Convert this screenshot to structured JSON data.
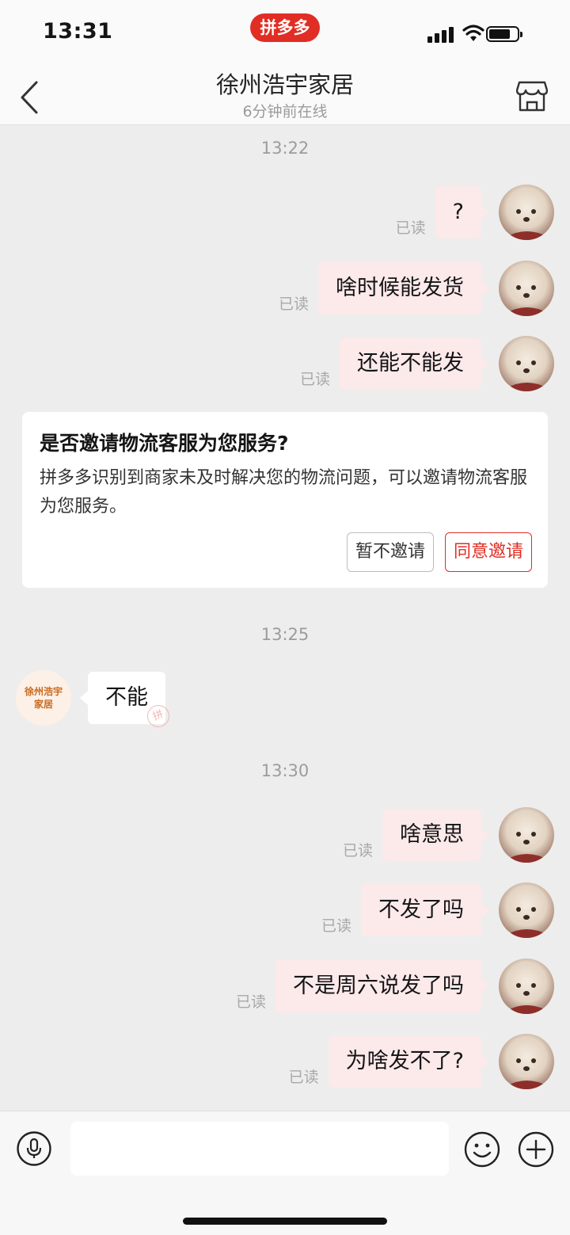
{
  "status_bar": {
    "time": "13:31",
    "brand": "拼多多"
  },
  "header": {
    "title": "徐州浩宇家居",
    "subtitle": "6分钟前在线"
  },
  "messages": {
    "time_1": "13:22",
    "m1": "?",
    "m2": "啥时候能发货",
    "m3": "还能不能发",
    "time_2": "13:25",
    "shop_reply": "不能",
    "time_3": "13:30",
    "m4": "啥意思",
    "m5": "不发了吗",
    "m6": "不是周六说发了吗",
    "m7": "为啥发不了?",
    "read_label": "已读"
  },
  "invite_card": {
    "title": "是否邀请物流客服为您服务?",
    "body": "拼多多识别到商家未及时解决您的物流问题，可以邀请物流客服为您服务。",
    "decline": "暂不邀请",
    "accept": "同意邀请"
  },
  "shop_avatar": {
    "line1": "徐州浩宇",
    "line2": "家居"
  },
  "stamp": "拼",
  "input_bar": {
    "placeholder": ""
  },
  "icons": [
    "back-arrow-icon",
    "store-icon",
    "microphone-icon",
    "emoji-icon",
    "plus-icon"
  ],
  "colors": {
    "brand_red": "#e02e24",
    "outgoing_bubble": "#fce9ea",
    "background": "#ededed"
  }
}
